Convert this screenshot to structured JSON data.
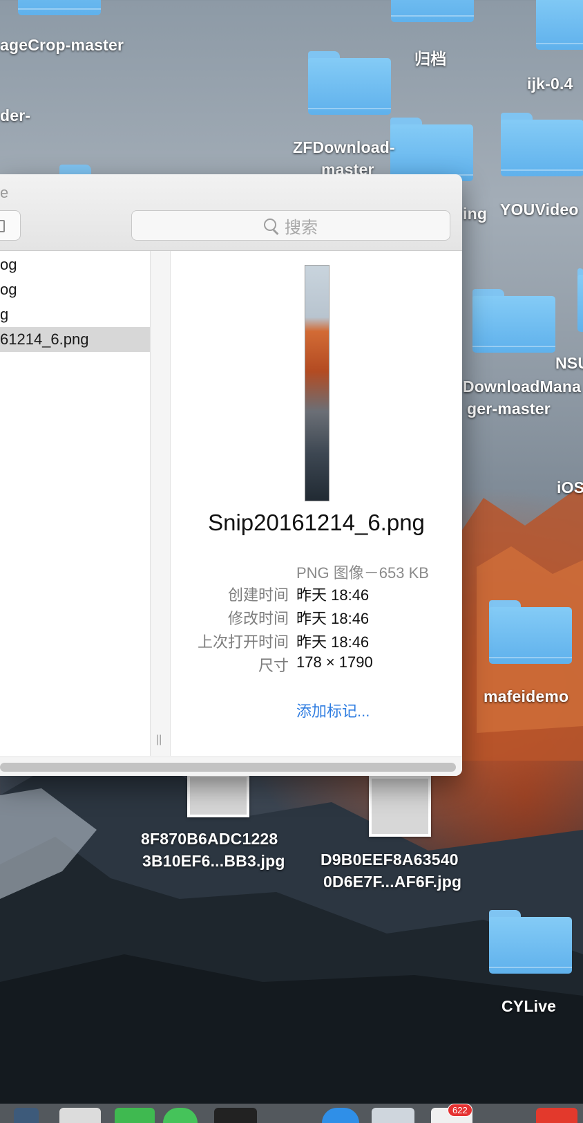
{
  "desktop": {
    "labels": {
      "image_crop": "ageCrop-master",
      "guidang": "归档",
      "ijk": "ijk-0.4",
      "der": "der-",
      "zfdownload_1": "ZFDownload-",
      "zfdownload_2": "master",
      "ing": "ing",
      "youvideo": "YOUVideo",
      "nsu": "NSU",
      "downloadmanager_1": "DownloadMana",
      "downloadmanager_2": "ger-master",
      "ios": "iOS",
      "mafeidemo": "mafeidemo",
      "file1_1": "8F870B6ADC1228",
      "file1_2": "3B10EF6...BB3.jpg",
      "file2_1": "D9B0EEF8A63540",
      "file2_2": "0D6E7F...AF6F.jpg",
      "cylive": "CYLive"
    },
    "dock_badge": "622"
  },
  "window": {
    "title": "e",
    "search_placeholder": "搜索",
    "list_items": [
      {
        "label": "og",
        "selected": false
      },
      {
        "label": "og",
        "selected": false
      },
      {
        "label": "g",
        "selected": false
      },
      {
        "label": "61214_6.png",
        "selected": true
      }
    ],
    "preview": {
      "file_name": "Snip20161214_6.png",
      "kind_size": "PNG 图像－653 KB",
      "meta": [
        {
          "key": "创建时间",
          "value": "昨天 18:46"
        },
        {
          "key": "修改时间",
          "value": "昨天 18:46"
        },
        {
          "key": "上次打开时间",
          "value": "昨天 18:46"
        },
        {
          "key": "尺寸",
          "value": "178 × 1790"
        }
      ],
      "add_tags": "添加标记..."
    },
    "resize_handle": "||"
  }
}
